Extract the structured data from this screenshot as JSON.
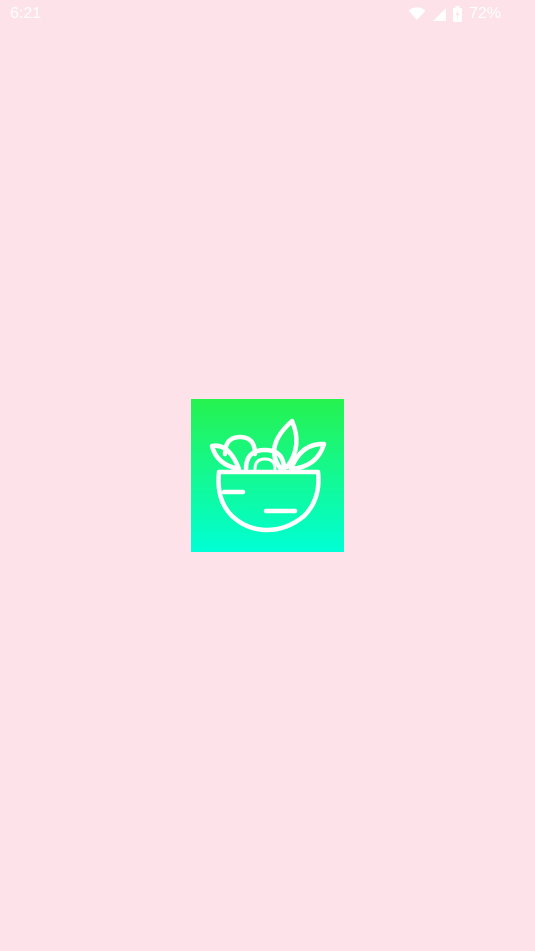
{
  "status_bar": {
    "time": "6:21",
    "battery_percent": "72%",
    "icons": [
      "wifi-icon",
      "cell-signal-icon",
      "battery-charging-icon"
    ]
  },
  "splash": {
    "logo_icon": "salad-bowl-icon",
    "colors": {
      "background": "#fde2ea",
      "logo_gradient_top": "#26f24f",
      "logo_gradient_bottom": "#00ffd5",
      "logo_stroke": "#ffffff"
    }
  }
}
